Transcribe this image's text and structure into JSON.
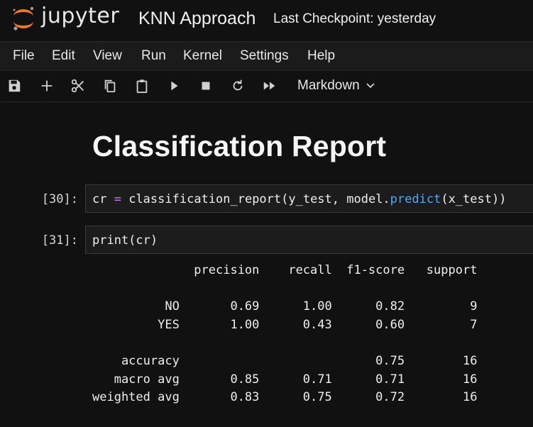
{
  "header": {
    "logo_text": "jupyter",
    "notebook_title": "KNN Approach",
    "checkpoint": "Last Checkpoint: yesterday"
  },
  "menu": [
    "File",
    "Edit",
    "View",
    "Run",
    "Kernel",
    "Settings",
    "Help"
  ],
  "toolbar": {
    "icons": [
      "save-icon",
      "add-cell-icon",
      "cut-icon",
      "copy-icon",
      "paste-icon",
      "run-icon",
      "stop-icon",
      "restart-icon",
      "fast-forward-icon"
    ],
    "cell_type": "Markdown"
  },
  "cells": {
    "heading": "Classification Report",
    "cell30": {
      "prompt": "[30]:",
      "code_parts": [
        "cr ",
        "=",
        " classification_report(y_test, model.",
        "predict",
        "(x_test))"
      ]
    },
    "cell31": {
      "prompt": "[31]:",
      "code": "print(cr)"
    }
  },
  "report": {
    "lines": [
      "              precision    recall  f1-score   support",
      "",
      "          NO       0.69      1.00      0.82         9",
      "         YES       1.00      0.43      0.60         7",
      "",
      "    accuracy                           0.75        16",
      "   macro avg       0.85      0.71      0.71        16",
      "weighted avg       0.83      0.75      0.72        16"
    ]
  },
  "colors": {
    "background": "#111111",
    "logo_orange": "#f37726",
    "keyword_purple": "#c97be6",
    "function_blue": "#4fa7ff"
  }
}
